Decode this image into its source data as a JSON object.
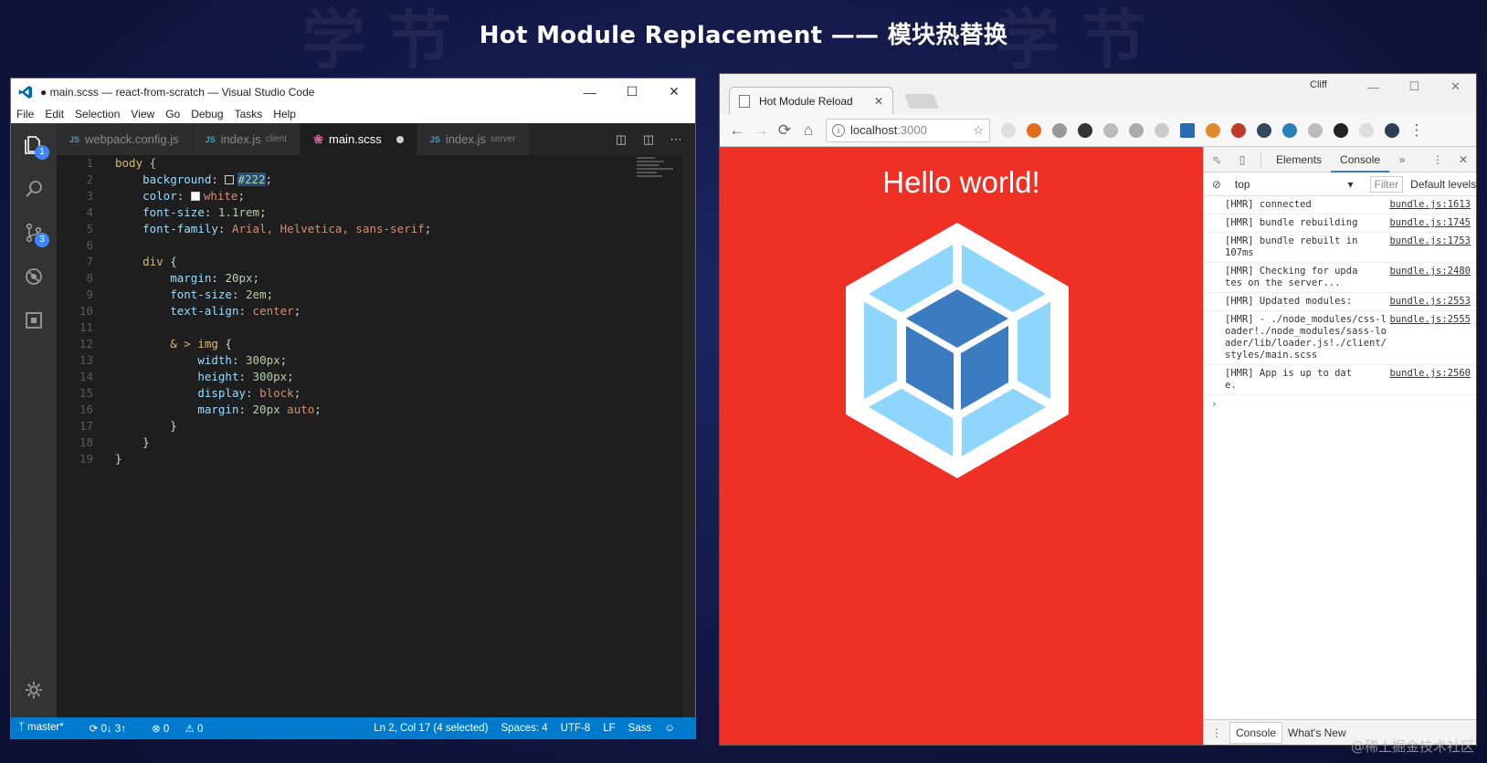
{
  "slide": {
    "title": "Hot Module Replacement —— 模块热替换",
    "watermark": "@稀土掘金技术社区"
  },
  "vscode": {
    "title": "● main.scss — react-from-scratch — Visual Studio Code",
    "menu": [
      "File",
      "Edit",
      "Selection",
      "View",
      "Go",
      "Debug",
      "Tasks",
      "Help"
    ],
    "activity_badges": {
      "explorer": "1",
      "scm": "3"
    },
    "tabs": [
      {
        "ext": "JS",
        "label": "webpack.config.js",
        "desc": ""
      },
      {
        "ext": "JS",
        "label": "index.js",
        "desc": "client"
      },
      {
        "ext": "",
        "label": "main.scss",
        "desc": ""
      },
      {
        "ext": "JS",
        "label": "index.js",
        "desc": "server"
      }
    ],
    "code_lines": [
      "body {",
      "    background: #222;",
      "    color: white;",
      "    font-size: 1.1rem;",
      "    font-family: Arial, Helvetica, sans-serif;",
      "",
      "    div {",
      "        margin: 20px;",
      "        font-size: 2em;",
      "        text-align: center;",
      "",
      "        & > img {",
      "            width: 300px;",
      "            height: 300px;",
      "            display: block;",
      "            margin: 20px auto;",
      "        }",
      "    }",
      "}"
    ],
    "status": {
      "branch": "master*",
      "sync": "0↓ 3↑",
      "errors": "0",
      "warnings": "0",
      "position": "Ln 2, Col 17 (4 selected)",
      "spaces": "Spaces: 4",
      "encoding": "UTF-8",
      "eol": "LF",
      "language": "Sass"
    }
  },
  "chrome": {
    "tab_title": "Hot Module Reload",
    "user": "Cliff",
    "url_host": "localhost",
    "url_port": ":3000",
    "page_heading": "Hello world!",
    "devtools": {
      "tabs": [
        "Elements",
        "Console"
      ],
      "active_tab": "Console",
      "context": "top",
      "filter_placeholder": "Filter",
      "levels": "Default levels",
      "logs": [
        {
          "msg": "[HMR] connected",
          "src": "bundle.js:1613"
        },
        {
          "msg": "[HMR] bundle rebuilding",
          "src": "bundle.js:1745"
        },
        {
          "msg": "[HMR] bundle rebuilt in 107ms",
          "src": "bundle.js:1753"
        },
        {
          "msg": "[HMR] Checking for updates on the server...",
          "src": "bundle.js:2480"
        },
        {
          "msg": "[HMR] Updated modules:",
          "src": "bundle.js:2553"
        },
        {
          "msg": "[HMR]  - ./node_modules/css-loader!./node_modules/sass-loader/lib/loader.js!./client/styles/main.scss",
          "src": "bundle.js:2555"
        },
        {
          "msg": "[HMR] App is up to date.",
          "src": "bundle.js:2560"
        }
      ],
      "drawer_tabs": [
        "Console",
        "What's New"
      ]
    }
  },
  "colors": {
    "page_bg": "#ee3124",
    "vs_status": "#007acc",
    "webpack_light": "#8ed6fb",
    "webpack_dark": "#1c78c0"
  }
}
